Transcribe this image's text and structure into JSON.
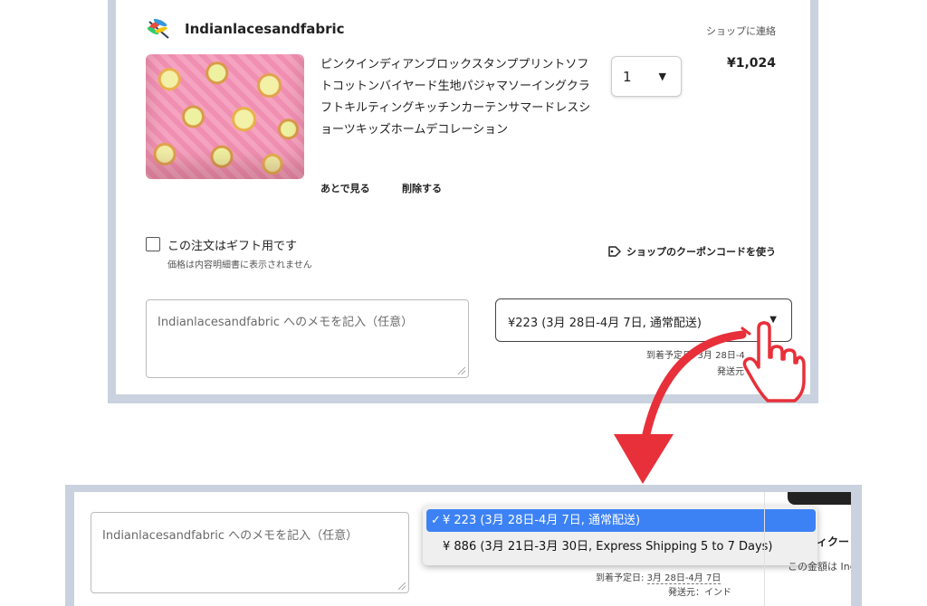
{
  "shop": {
    "name": "Indianlacesandfabric",
    "contact_label": "ショップに連絡"
  },
  "product": {
    "title": "ピンクインディアンブロックスタンププリントソフトコットンバイヤード生地パジャマソーイングクラフトキルティングキッチンカーテンサマードレスショーツキッズホームデコレーション",
    "quantity": "1",
    "price": "¥1,024",
    "save_later_label": "あとで見る",
    "delete_label": "削除する"
  },
  "gift": {
    "label": "この注文はギフト用です",
    "note": "価格は内容明細書に表示されません"
  },
  "coupon": {
    "label": "ショップのクーポンコードを使う"
  },
  "memo": {
    "placeholder": "Indianlacesandfabric へのメモを記入（任意）"
  },
  "shipping": {
    "selected": "¥223 (3月 28日-4月 7日, 通常配送)",
    "arrival_partial": "到着予定日: 3月 28日-4",
    "origin_partial": "発送元",
    "options": [
      {
        "label": "¥ 223 (3月 28日-4月 7日, 通常配送)",
        "selected": true
      },
      {
        "label": "¥ 886 (3月 21日-3月 30日, Express Shipping 5 to 7 Days)",
        "selected": false
      }
    ],
    "check_mark": "✓",
    "arrival_label": "到着予定日:",
    "arrival_dates": "3月 28日-4月 7日",
    "origin_full": "発送元：インド"
  },
  "side_panel": {
    "partial_heading": "ィクー",
    "partial_text": "この金額は Ind"
  },
  "colors": {
    "frame": "#c9d2de",
    "highlight": "#3d82f5",
    "arrow": "#e8303a"
  }
}
